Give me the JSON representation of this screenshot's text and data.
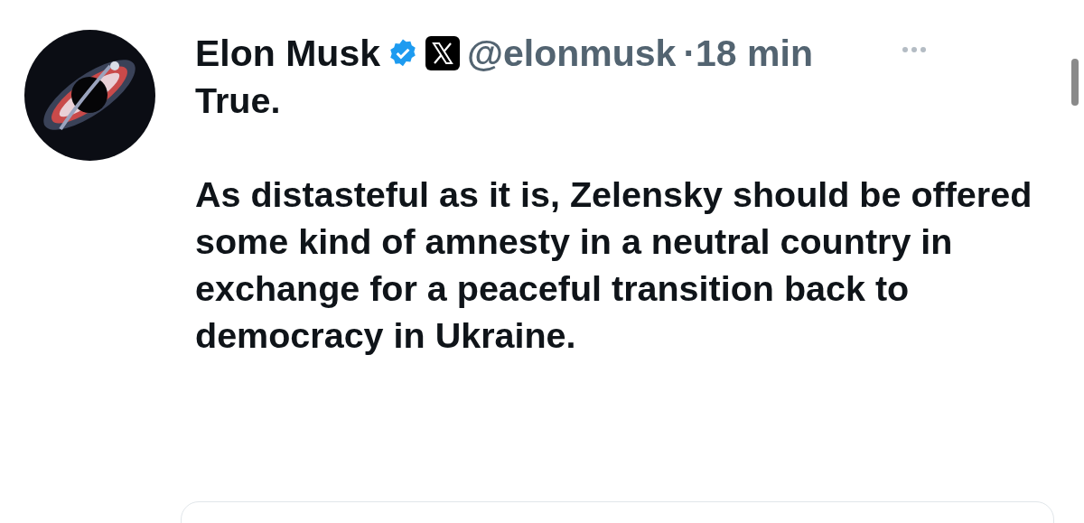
{
  "post": {
    "author": {
      "name": "Elon Musk",
      "verified": true,
      "handle": "@elonmusk",
      "separator": "·",
      "time": "18 min"
    },
    "text": [
      "True.",
      "As distasteful as it is, Zelensky should be offered some kind of amnesty in a neutral country in exchange for a peaceful transition back to democracy in Ukraine."
    ]
  }
}
